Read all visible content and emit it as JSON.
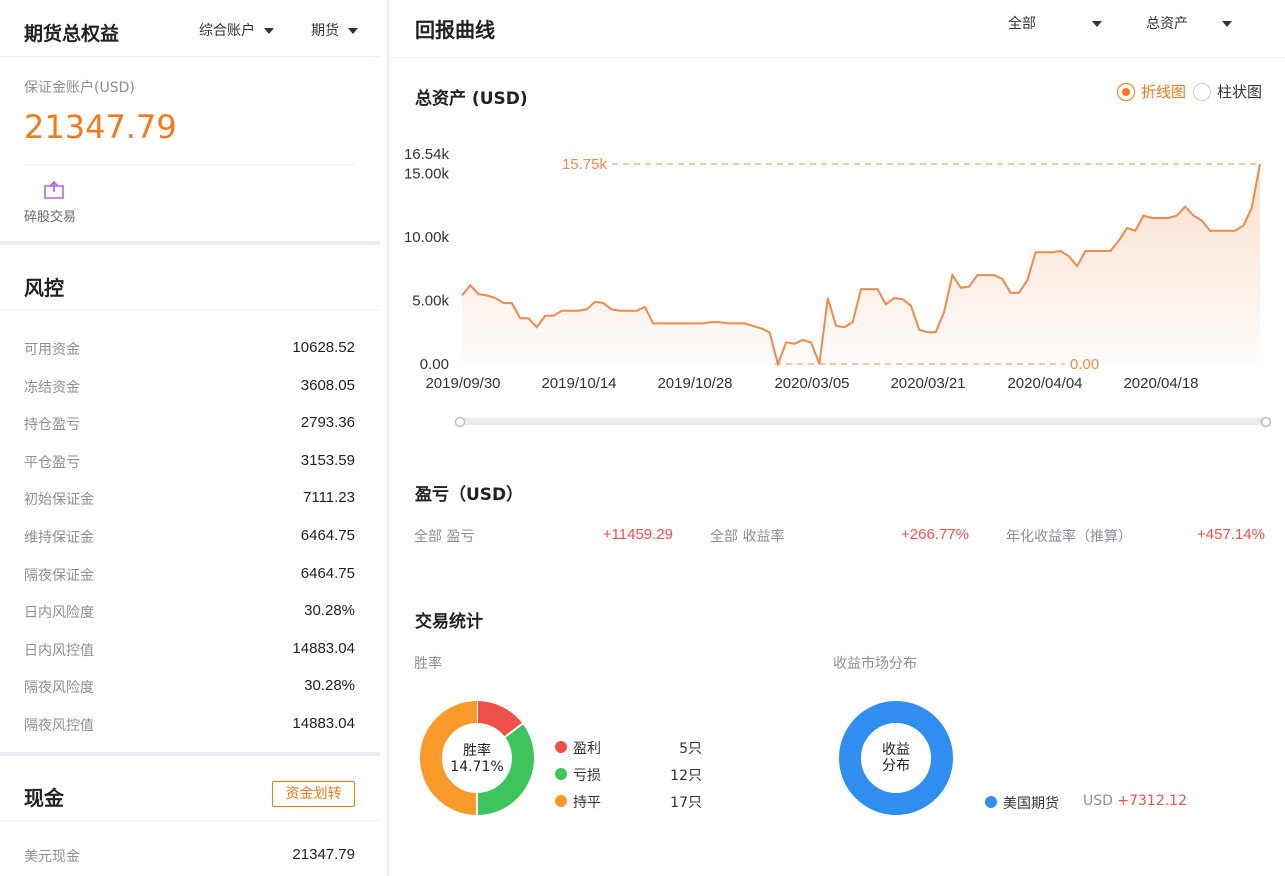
{
  "left": {
    "header": {
      "title": "期货总权益",
      "account_dropdown": "综合账户",
      "type_dropdown": "期货"
    },
    "account": {
      "label": "保证金账户(USD)",
      "value": "21347.79"
    },
    "odd_lot": {
      "label": "碎股交易",
      "icon": "odd-lot-trade-icon"
    },
    "risk": {
      "title": "风控",
      "rows": [
        {
          "label": "可用资金",
          "value": "10628.52"
        },
        {
          "label": "冻结资金",
          "value": "3608.05"
        },
        {
          "label": "持仓盈亏",
          "value": "2793.36"
        },
        {
          "label": "平仓盈亏",
          "value": "3153.59"
        },
        {
          "label": "初始保证金",
          "value": "7111.23"
        },
        {
          "label": "维持保证金",
          "value": "6464.75"
        },
        {
          "label": "隔夜保证金",
          "value": "6464.75"
        },
        {
          "label": "日内风险度",
          "value": "30.28%"
        },
        {
          "label": "日内风控值",
          "value": "14883.04"
        },
        {
          "label": "隔夜风险度",
          "value": "30.28%"
        },
        {
          "label": "隔夜风控值",
          "value": "14883.04"
        }
      ]
    },
    "cash": {
      "title": "现金",
      "transfer_button": "资金划转",
      "row": {
        "label": "美元现金",
        "value": "21347.79"
      }
    }
  },
  "right": {
    "header": {
      "title": "回报曲线",
      "range_dropdown": "全部",
      "metric_dropdown": "总资产"
    },
    "chart_title": "总资产 (USD)",
    "chart_types": {
      "line": "折线图",
      "bar": "柱状图",
      "selected": "line"
    },
    "colors": {
      "accent": "#f5781b",
      "line": "#f08a4b",
      "profit": "#f0504c",
      "loss": "#3ec45c",
      "flat": "#f99a2a",
      "market": "#2f8ef0"
    },
    "pl": {
      "title": "盈亏（USD）",
      "items": [
        {
          "label": "全部 盈亏",
          "value": "+11459.29"
        },
        {
          "label": "全部 收益率",
          "value": "+266.77%"
        },
        {
          "label": "年化收益率（推算）",
          "value": "+457.14%"
        }
      ]
    },
    "trade_stats": {
      "title": "交易统计",
      "win_rate": {
        "label": "胜率",
        "center_label": "胜率",
        "center_value": "14.71%",
        "items": [
          {
            "label": "盈利",
            "count": "5只",
            "value": 5,
            "color": "#f0504c"
          },
          {
            "label": "亏损",
            "count": "12只",
            "value": 12,
            "color": "#3ec45c"
          },
          {
            "label": "持平",
            "count": "17只",
            "value": 17,
            "color": "#f99a2a"
          }
        ]
      },
      "market": {
        "label": "收益市场分布",
        "center_line1": "收益",
        "center_line2": "分布",
        "items": [
          {
            "label": "美国期货",
            "currency": "USD",
            "value": "+7312.12",
            "color": "#2f8ef0"
          }
        ]
      }
    }
  },
  "chart_data": {
    "type": "area",
    "title": "总资产 (USD)",
    "xlabel": "",
    "ylabel": "",
    "ylim": [
      0,
      16540
    ],
    "y_ticks": [
      "0.00",
      "5.00k",
      "10.00k",
      "15.00k",
      "16.54k"
    ],
    "y_tick_values": [
      0,
      5000,
      10000,
      15000,
      16540
    ],
    "x_tick_labels": [
      "2019/09/30",
      "2019/10/14",
      "2019/10/28",
      "2020/03/05",
      "2020/03/21",
      "2020/04/04",
      "2020/04/18"
    ],
    "max_label": "15.75k",
    "max_value": 15750,
    "min_label": "0.00",
    "min_value": 0,
    "grid": false,
    "series": [
      {
        "values": [
          5400,
          6200,
          5500,
          5400,
          5200,
          4800,
          4800,
          3600,
          3600,
          2900,
          3800,
          3800,
          4200,
          4200,
          4200,
          4300,
          4900,
          4800,
          4300,
          4200,
          4200,
          4200,
          4500,
          3200,
          3200,
          3200,
          3200,
          3200,
          3200,
          3200,
          3300,
          3300,
          3200,
          3200,
          3200,
          3000,
          2800,
          2500,
          0,
          1700,
          1600,
          1900,
          1700,
          0,
          5200,
          3000,
          2900,
          3300,
          5900,
          5900,
          5900,
          4700,
          5200,
          5100,
          4600,
          2700,
          2500,
          2500,
          4100,
          7000,
          6000,
          6100,
          7000,
          7000,
          7000,
          6700,
          5600,
          5600,
          6600,
          8800,
          8800,
          8800,
          8900,
          8500,
          7700,
          8900,
          8900,
          8900,
          8900,
          9700,
          10700,
          10500,
          11700,
          11500,
          11500,
          11500,
          11700,
          12400,
          11700,
          11300,
          10500,
          10500,
          10500,
          10500,
          10900,
          12300,
          15750
        ]
      }
    ]
  }
}
